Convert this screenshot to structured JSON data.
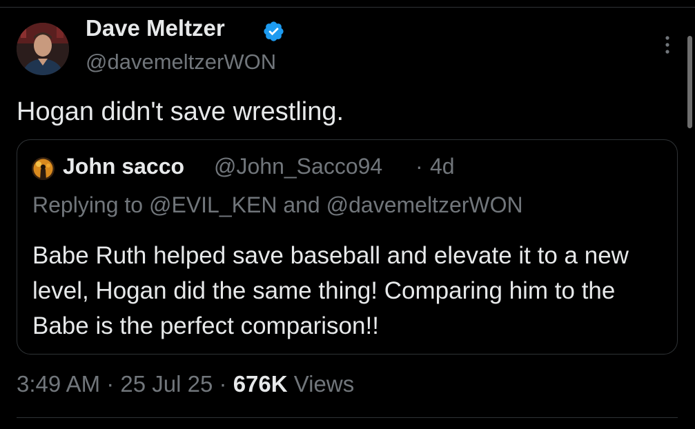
{
  "tweet": {
    "author": {
      "name": "Dave Meltzer",
      "handle": "@davemeltzerWON",
      "verified": true,
      "verified_color": "#1d9bf0"
    },
    "text": "Hogan didn't save wrestling.",
    "more_icon": "more-vertical-icon"
  },
  "quote": {
    "author": {
      "name": "John sacco",
      "handle": "@John_Sacco94",
      "separator": "·",
      "time": "4d"
    },
    "replying_to": "Replying to @EVIL_KEN and @davemeltzerWON",
    "text": "Babe Ruth helped save baseball and elevate it to a new level, Hogan did the same thing! Comparing him to the Babe is the perfect comparison!!"
  },
  "meta": {
    "time": "3:49 AM",
    "date": "25 Jul 25",
    "views_count": "676K",
    "views_label": "Views",
    "separator": "·"
  },
  "colors": {
    "background": "#000000",
    "text_primary": "#e7e9ea",
    "text_secondary": "#71767b",
    "border": "#2f3336"
  }
}
